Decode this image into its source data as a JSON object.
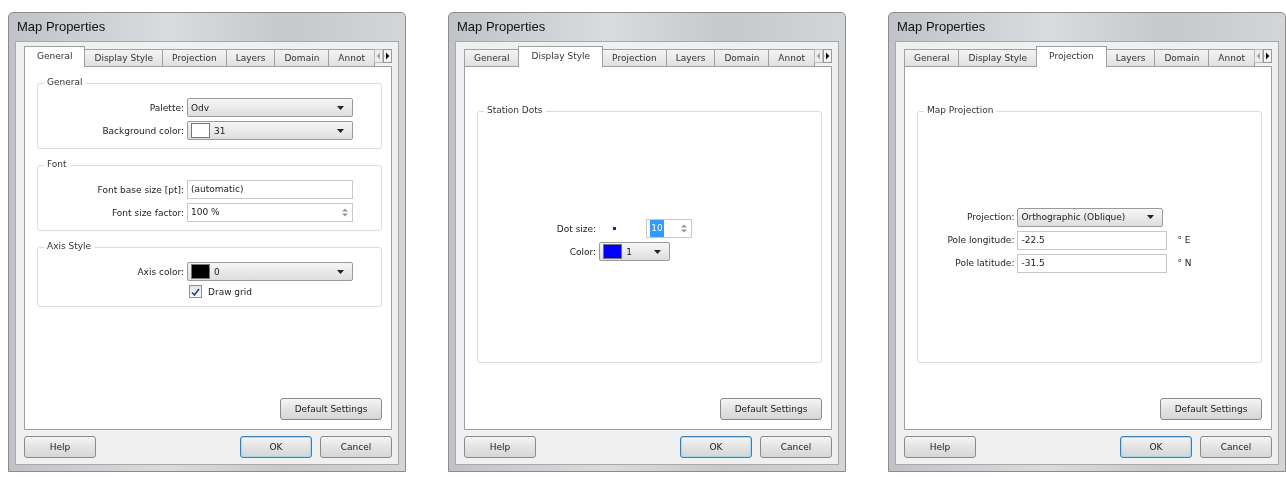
{
  "dialogs": [
    {
      "title": "Map Properties",
      "kind": "stacked",
      "tabs": [
        {
          "label": "General",
          "selected": true
        },
        {
          "label": "Display Style",
          "selected": false
        },
        {
          "label": "Projection",
          "selected": false
        },
        {
          "label": "Layers",
          "selected": false
        },
        {
          "label": "Domain",
          "selected": false
        },
        {
          "label": "Annot",
          "selected": false
        }
      ],
      "groups": [
        {
          "title": "General",
          "rows": [
            {
              "kind": "combo",
              "label": "Palette:",
              "value": "Odv"
            },
            {
              "kind": "combo",
              "label": "Background color:",
              "value": "31",
              "color": "#ffffff"
            }
          ]
        },
        {
          "title": "Font",
          "rows": [
            {
              "kind": "field",
              "label": "Font base size [pt]:",
              "value": "(automatic)"
            },
            {
              "kind": "spin",
              "label": "Font size factor:",
              "value": "100 %"
            }
          ]
        },
        {
          "title": "Axis Style",
          "rows": [
            {
              "kind": "combo",
              "label": "Axis color:",
              "value": "0",
              "color": "#000000"
            },
            {
              "kind": "checkbox",
              "label": "Draw grid",
              "checked": true
            }
          ]
        }
      ],
      "default_button": "Default Settings",
      "buttons": [
        {
          "label": "Help",
          "kind": "help"
        },
        {
          "label": "OK",
          "kind": "default"
        },
        {
          "label": "Cancel",
          "kind": "normal"
        }
      ]
    },
    {
      "title": "Map Properties",
      "kind": "centered",
      "tabs": [
        {
          "label": "General",
          "selected": false
        },
        {
          "label": "Display Style",
          "selected": true
        },
        {
          "label": "Projection",
          "selected": false
        },
        {
          "label": "Layers",
          "selected": false
        },
        {
          "label": "Domain",
          "selected": false
        },
        {
          "label": "Annot",
          "selected": false
        }
      ],
      "groups": [
        {
          "title": "Station Dots",
          "rows": [
            {
              "kind": "dot-spin",
              "label": "Dot size:",
              "value": "10",
              "highlighted": true
            },
            {
              "kind": "combo",
              "label": "Color:",
              "value": "1",
              "color": "#0000ff"
            }
          ]
        }
      ],
      "default_button": "Default Settings",
      "buttons": [
        {
          "label": "Help",
          "kind": "help"
        },
        {
          "label": "OK",
          "kind": "default"
        },
        {
          "label": "Cancel",
          "kind": "normal"
        }
      ]
    },
    {
      "title": "Map Properties",
      "kind": "centered",
      "tabs": [
        {
          "label": "General",
          "selected": false
        },
        {
          "label": "Display Style",
          "selected": false
        },
        {
          "label": "Projection",
          "selected": true
        },
        {
          "label": "Layers",
          "selected": false
        },
        {
          "label": "Domain",
          "selected": false
        },
        {
          "label": "Annot",
          "selected": false
        }
      ],
      "groups": [
        {
          "title": "Map Projection",
          "rows": [
            {
              "kind": "combo",
              "label": "Projection:",
              "value": "Orthographic (Oblique)"
            },
            {
              "kind": "field",
              "label": "Pole longitude:",
              "value": "-22.5",
              "unit": "° E"
            },
            {
              "kind": "field",
              "label": "Pole latitude:",
              "value": "-31.5",
              "unit": "° N"
            }
          ]
        }
      ],
      "default_button": "Default Settings",
      "buttons": [
        {
          "label": "Help",
          "kind": "help"
        },
        {
          "label": "OK",
          "kind": "default"
        },
        {
          "label": "Cancel",
          "kind": "normal"
        }
      ]
    }
  ]
}
